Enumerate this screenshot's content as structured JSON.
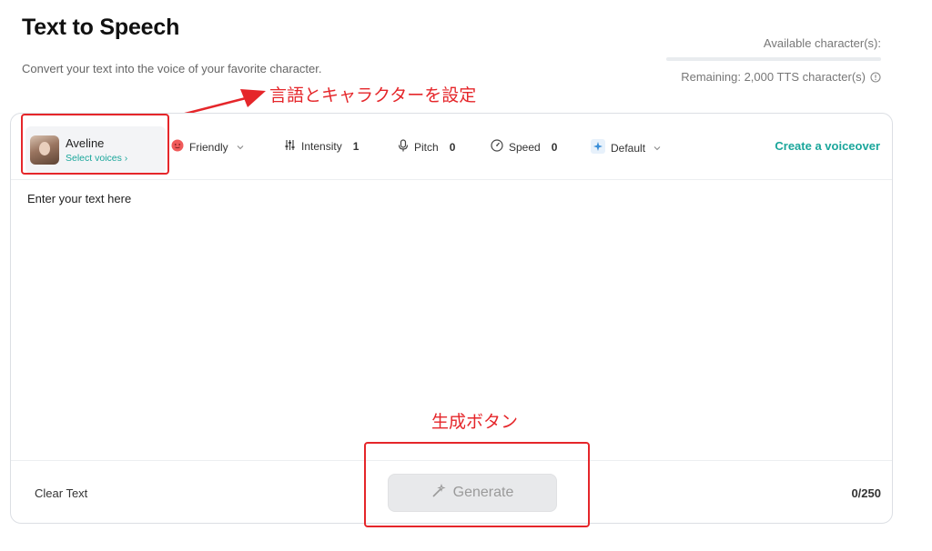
{
  "header": {
    "title": "Text to Speech",
    "subtitle": "Convert your text into the voice of your favorite character."
  },
  "quota": {
    "label": "Available character(s):",
    "remaining": "Remaining: 2,000 TTS character(s)",
    "used_fraction": 0,
    "info_icon": "info-circle-icon"
  },
  "annotations": {
    "top": "言語とキャラクターを設定",
    "bottom": "生成ボタン",
    "color": "#e5262a"
  },
  "voice": {
    "name": "Aveline",
    "select_label": "Select voices ›"
  },
  "toolbar": {
    "emotion": {
      "label": "Friendly",
      "icon": "friendly-emoji-icon"
    },
    "intensity": {
      "label": "Intensity",
      "value": "1",
      "icon": "sliders-icon"
    },
    "pitch": {
      "label": "Pitch",
      "value": "0",
      "icon": "microphone-icon"
    },
    "speed": {
      "label": "Speed",
      "value": "0",
      "icon": "gauge-icon"
    },
    "style": {
      "label": "Default",
      "icon": "sparkle-icon"
    },
    "create_voiceover": "Create a voiceover"
  },
  "editor": {
    "placeholder": "Enter your text here",
    "value": ""
  },
  "footer": {
    "clear_label": "Clear Text",
    "generate_label": "Generate",
    "char_count": "0/250"
  },
  "colors": {
    "accent": "#1aa69b",
    "annotation": "#e5262a",
    "generate_bg": "#e8e9eb"
  }
}
